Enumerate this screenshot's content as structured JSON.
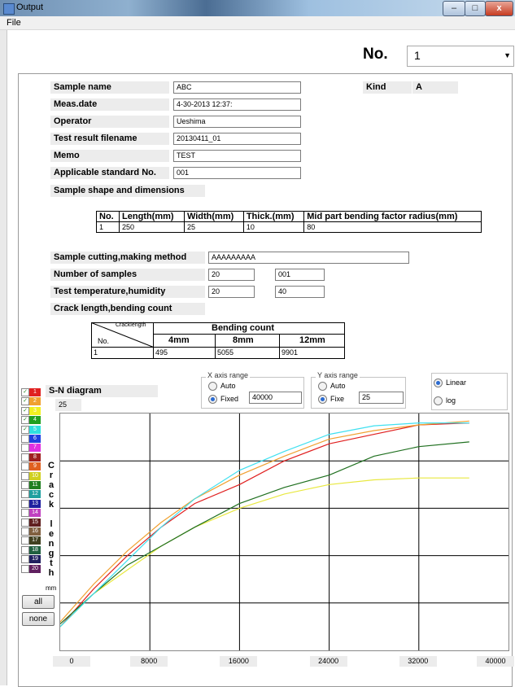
{
  "window": {
    "title": "Output",
    "min_icon": "minimize-icon",
    "max_icon": "maximize-icon",
    "close_icon": "close-icon"
  },
  "menu": {
    "file": "File"
  },
  "no_selector": {
    "label": "No.",
    "value": "1"
  },
  "fields": {
    "sample_name": {
      "label": "Sample name",
      "value": "ABC"
    },
    "meas_date": {
      "label": "Meas.date",
      "value": "4-30-2013 12:37:"
    },
    "operator": {
      "label": "Operator",
      "value": "Ueshima"
    },
    "test_result_filename": {
      "label": "Test result filename",
      "value": "20130411_01"
    },
    "memo": {
      "label": "Memo",
      "value": "TEST"
    },
    "applicable_standard": {
      "label": "Applicable standard No.",
      "value": "001"
    },
    "sample_shape_label": "Sample shape and dimensions",
    "kind": {
      "label": "Kind",
      "value": "A"
    }
  },
  "dimensions_table": {
    "headers": [
      "No.",
      "Length(mm)",
      "Width(mm)",
      "Thick.(mm)",
      "Mid part bending factor radius(mm)"
    ],
    "row": [
      "1",
      "250",
      "25",
      "10",
      "80"
    ]
  },
  "cutting": {
    "label": "Sample cutting,making method",
    "value": "AAAAAAAAA"
  },
  "num_samples": {
    "label": "Number of samples",
    "value1": "20",
    "value2": "001"
  },
  "temp_humidity": {
    "label": "Test temperature,humidity",
    "value1": "20",
    "value2": "40"
  },
  "crack_label": "Crack length,bending count",
  "bending_table": {
    "corner_top": "Cracklength",
    "corner_bottom": "No.",
    "group_header": "Bending count",
    "cols": [
      "4mm",
      "8mm",
      "12mm"
    ],
    "row": [
      "1",
      "495",
      "5055",
      "9901"
    ]
  },
  "sn": {
    "label": "S-N diagram",
    "value": "25"
  },
  "x_axis_range": {
    "title": "X axis range",
    "auto": "Auto",
    "fixed": "Fixed",
    "value": "40000",
    "selected": "Fixed"
  },
  "y_axis_range": {
    "title": "Y axis range",
    "auto": "Auto",
    "fixed": "Fixe",
    "value": "25",
    "selected": "Fixe"
  },
  "scale": {
    "linear": "Linear",
    "log": "log",
    "selected": "Linear"
  },
  "series_list": [
    {
      "n": "1",
      "color": "#e02020",
      "checked": true
    },
    {
      "n": "2",
      "color": "#f0a030",
      "checked": true
    },
    {
      "n": "3",
      "color": "#f0f020",
      "checked": true
    },
    {
      "n": "4",
      "color": "#20a020",
      "checked": true
    },
    {
      "n": "5",
      "color": "#30e0e0",
      "checked": true
    },
    {
      "n": "6",
      "color": "#2040e0",
      "checked": false
    },
    {
      "n": "7",
      "color": "#e030e0",
      "checked": false
    },
    {
      "n": "8",
      "color": "#a02020",
      "checked": false
    },
    {
      "n": "9",
      "color": "#e06020",
      "checked": false
    },
    {
      "n": "10",
      "color": "#d0d020",
      "checked": false
    },
    {
      "n": "11",
      "color": "#208020",
      "checked": false
    },
    {
      "n": "12",
      "color": "#20a0a0",
      "checked": false
    },
    {
      "n": "13",
      "color": "#2020a0",
      "checked": false
    },
    {
      "n": "14",
      "color": "#c040c0",
      "checked": false
    },
    {
      "n": "15",
      "color": "#602020",
      "checked": false
    },
    {
      "n": "16",
      "color": "#806040",
      "checked": false
    },
    {
      "n": "17",
      "color": "#404020",
      "checked": false
    },
    {
      "n": "18",
      "color": "#206040",
      "checked": false
    },
    {
      "n": "19",
      "color": "#202060",
      "checked": false
    },
    {
      "n": "20",
      "color": "#602060",
      "checked": false
    }
  ],
  "vertical_label": [
    "C",
    "r",
    "a",
    "c",
    "k",
    " ",
    "l",
    "e",
    "n",
    "g",
    "t",
    "h"
  ],
  "unit_label": "mm",
  "buttons": {
    "all": "all",
    "none": "none"
  },
  "chart_data": {
    "type": "line",
    "xlim": [
      0,
      40000
    ],
    "ylim": [
      0,
      25
    ],
    "x_tick_labels": [
      "0",
      "8000",
      "16000",
      "24000",
      "32000",
      "40000"
    ],
    "grid": true,
    "series": [
      {
        "color": "#e02020",
        "points": [
          [
            0,
            2.5
          ],
          [
            3000,
            6.5
          ],
          [
            6000,
            10
          ],
          [
            9000,
            13
          ],
          [
            12000,
            15.5
          ],
          [
            16000,
            17.5
          ],
          [
            20000,
            20
          ],
          [
            24000,
            21.8
          ],
          [
            28000,
            22.8
          ],
          [
            32000,
            23.8
          ],
          [
            36500,
            24
          ]
        ]
      },
      {
        "color": "#f0a030",
        "points": [
          [
            0,
            3
          ],
          [
            3000,
            7
          ],
          [
            6000,
            10.5
          ],
          [
            9000,
            13.5
          ],
          [
            12000,
            16
          ],
          [
            16000,
            18.5
          ],
          [
            20000,
            20.5
          ],
          [
            24000,
            22.3
          ],
          [
            28000,
            23.2
          ],
          [
            32000,
            23.8
          ],
          [
            36500,
            24.2
          ]
        ]
      },
      {
        "color": "#e8e840",
        "points": [
          [
            0,
            2.5
          ],
          [
            3000,
            6
          ],
          [
            6000,
            8.5
          ],
          [
            9000,
            11
          ],
          [
            12000,
            13
          ],
          [
            16000,
            15
          ],
          [
            20000,
            16.5
          ],
          [
            24000,
            17.5
          ],
          [
            28000,
            18
          ],
          [
            32000,
            18.2
          ],
          [
            36500,
            18.2
          ]
        ]
      },
      {
        "color": "#207020",
        "points": [
          [
            0,
            2.8
          ],
          [
            3000,
            6
          ],
          [
            6000,
            9
          ],
          [
            9000,
            11
          ],
          [
            12000,
            13
          ],
          [
            16000,
            15.5
          ],
          [
            20000,
            17.2
          ],
          [
            24000,
            18.5
          ],
          [
            28000,
            20.5
          ],
          [
            32000,
            21.5
          ],
          [
            36500,
            22
          ]
        ]
      },
      {
        "color": "#40e0f0",
        "points": [
          [
            0,
            2.5
          ],
          [
            3000,
            6
          ],
          [
            6000,
            9.5
          ],
          [
            9000,
            13
          ],
          [
            12000,
            16
          ],
          [
            16000,
            19
          ],
          [
            20000,
            21
          ],
          [
            24000,
            22.8
          ],
          [
            28000,
            23.7
          ],
          [
            32000,
            24
          ],
          [
            36500,
            24
          ]
        ]
      }
    ]
  }
}
